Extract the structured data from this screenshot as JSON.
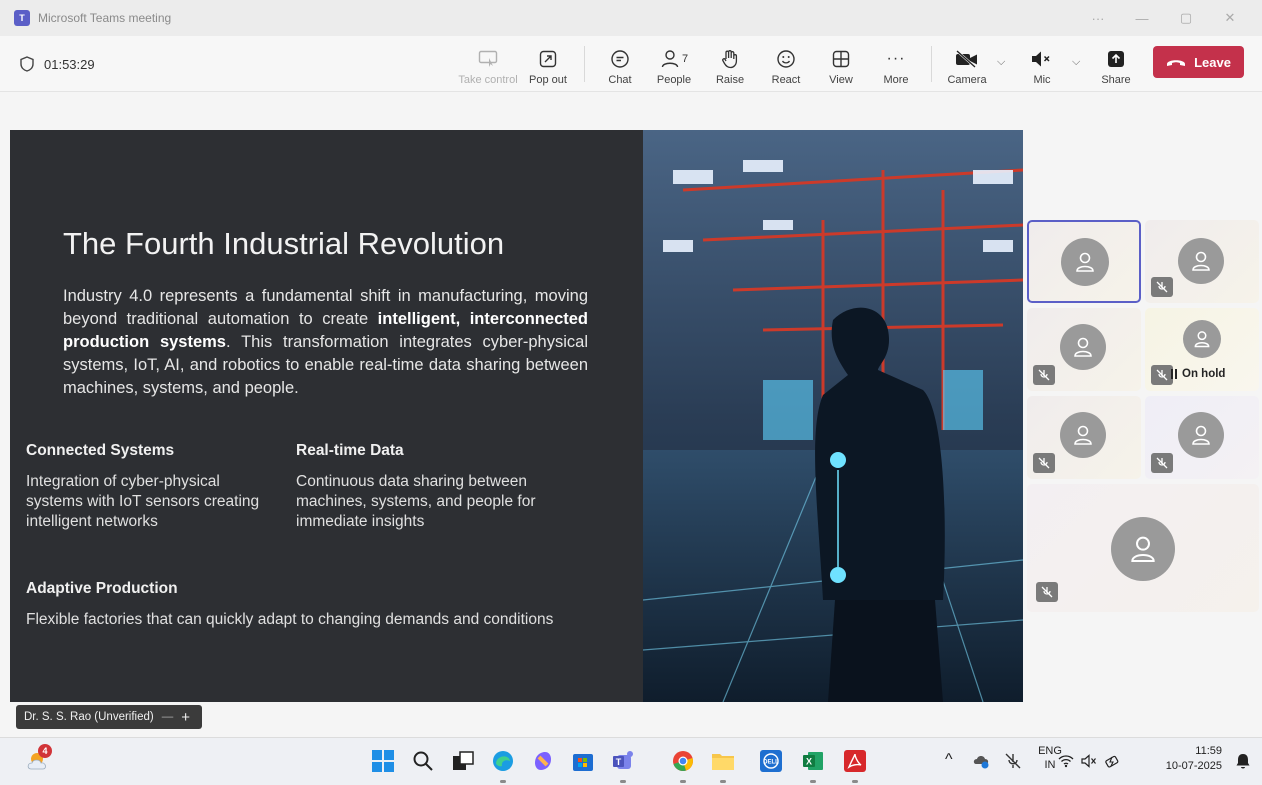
{
  "window": {
    "title": "Microsoft Teams meeting",
    "more": "···",
    "minimize": "—",
    "restore": "▢",
    "close": "✕"
  },
  "toolbar": {
    "timer": "01:53:29",
    "take_control": "Take control",
    "pop_out": "Pop out",
    "chat": "Chat",
    "people": "People",
    "people_count": "7",
    "raise": "Raise",
    "react": "React",
    "view": "View",
    "more": "More",
    "camera": "Camera",
    "mic": "Mic",
    "share": "Share",
    "leave": "Leave"
  },
  "slide": {
    "title": "The Fourth Industrial Revolution",
    "intro_1": "Industry 4.0 represents a fundamental shift in manufacturing, moving beyond traditional automation to create ",
    "intro_bold": "intelligent, interconnected production systems",
    "intro_2": ". This transformation integrates cyber-physical systems, IoT, AI, and robotics to enable real-time data sharing between machines, systems, and people.",
    "sections": [
      {
        "heading": "Connected Systems",
        "body": "Integration of cyber-physical systems with IoT sensors creating intelligent networks"
      },
      {
        "heading": "Real-time Data",
        "body": "Continuous data sharing between machines, systems, and people for immediate insights"
      },
      {
        "heading": "Adaptive Production",
        "body": "Flexible factories that can quickly adapt to changing demands and conditions"
      }
    ]
  },
  "participants": {
    "on_hold": "On hold"
  },
  "presenter": {
    "name": "Dr. S. S. Rao (Unverified)",
    "minus": "—",
    "plus": "+"
  },
  "taskbar": {
    "weather_badge": "4",
    "lang_1": "ENG",
    "lang_2": "IN",
    "time": "11:59",
    "date": "10-07-2025",
    "up_arrow": "^"
  },
  "colors": {
    "accent": "#5b5fc7",
    "leave": "#c4314b",
    "slide_bg": "#2d2f33"
  }
}
